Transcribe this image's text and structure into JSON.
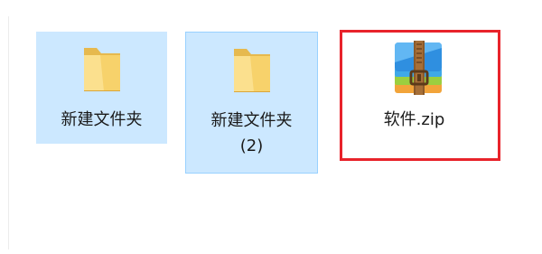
{
  "files": [
    {
      "name": "新建文件夹",
      "type": "folder",
      "icon": "folder-icon",
      "state": "selected"
    },
    {
      "name": "新建文件夹\n(2)",
      "type": "folder",
      "icon": "folder-icon",
      "state": "selected-focused"
    },
    {
      "name": "软件.zip",
      "type": "zip-archive",
      "icon": "zip-archive-icon",
      "state": "normal"
    }
  ],
  "colors": {
    "selection_bg": "#cce8ff",
    "selection_border": "#99d1ff",
    "highlight_box": "#e8232b",
    "folder": "#f7d26b"
  }
}
